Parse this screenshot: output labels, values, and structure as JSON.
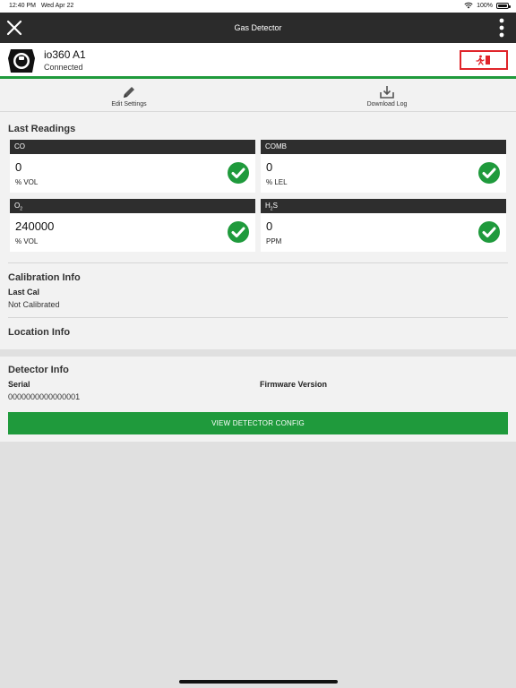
{
  "status_bar": {
    "time": "12:40 PM",
    "date": "Wed Apr 22",
    "battery": "100%"
  },
  "navbar": {
    "title": "Gas Detector",
    "close_icon": "close-icon",
    "more_icon": "more-vertical-icon"
  },
  "device": {
    "name": "io360 A1",
    "status": "Connected",
    "accent_color": "#1f9a3c",
    "evac_color": "#e0242a"
  },
  "toolbar": {
    "edit_label": "Edit Settings",
    "download_label": "Download Log"
  },
  "last_readings": {
    "title": "Last Readings",
    "sensors": [
      {
        "name": "CO",
        "value": "0",
        "unit": "% VOL"
      },
      {
        "name": "COMB",
        "value": "0",
        "unit": "% LEL"
      },
      {
        "name_main": "O",
        "name_sub": "2",
        "value": "240000",
        "unit": "% VOL"
      },
      {
        "name_main": "H",
        "name_sub": "2",
        "name_tail": "S",
        "value": "0",
        "unit": "PPM"
      }
    ]
  },
  "calibration": {
    "title": "Calibration Info",
    "last_cal_label": "Last Cal",
    "last_cal_value": "Not Calibrated"
  },
  "location": {
    "title": "Location Info"
  },
  "detector": {
    "title": "Detector Info",
    "serial_label": "Serial",
    "serial_value": "0000000000000001",
    "firmware_label": "Firmware Version",
    "config_button": "VIEW DETECTOR CONFIG"
  }
}
